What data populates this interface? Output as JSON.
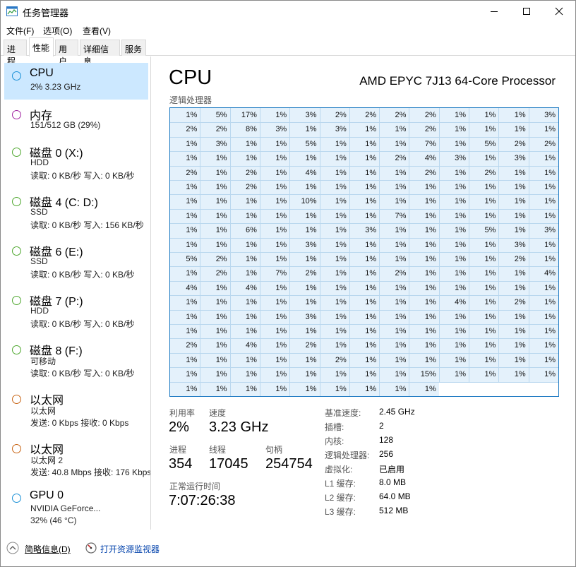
{
  "window": {
    "title": "任务管理器"
  },
  "menu": [
    {
      "label": "文件(F)"
    },
    {
      "label": "选项(O)"
    },
    {
      "label": "查看(V)"
    }
  ],
  "tabs": [
    {
      "label": "进程"
    },
    {
      "label": "性能"
    },
    {
      "label": "用户"
    },
    {
      "label": "详细信息"
    },
    {
      "label": "服务"
    }
  ],
  "sidebar": {
    "items": [
      {
        "title": "CPU",
        "lines": [
          "2% 3.23 GHz"
        ],
        "color": "#1a90d6"
      },
      {
        "title": "内存",
        "lines": [
          "151/512 GB (29%)"
        ],
        "color": "#a024a0"
      },
      {
        "title": "磁盘 0 (X:)",
        "lines": [
          "HDD",
          "读取: 0 KB/秒 写入: 0 KB/秒"
        ],
        "color": "#4ea72e"
      },
      {
        "title": "磁盘 4 (C: D:)",
        "lines": [
          "SSD",
          "读取: 0 KB/秒 写入: 156 KB/秒"
        ],
        "color": "#4ea72e"
      },
      {
        "title": "磁盘 6 (E:)",
        "lines": [
          "SSD",
          "读取: 0 KB/秒 写入: 0 KB/秒"
        ],
        "color": "#4ea72e"
      },
      {
        "title": "磁盘 7 (P:)",
        "lines": [
          "HDD",
          "读取: 0 KB/秒 写入: 0 KB/秒"
        ],
        "color": "#4ea72e"
      },
      {
        "title": "磁盘 8 (F:)",
        "lines": [
          "可移动",
          "读取: 0 KB/秒 写入: 0 KB/秒"
        ],
        "color": "#4ea72e"
      },
      {
        "title": "以太网",
        "lines": [
          "以太网",
          "发送: 0 Kbps 接收: 0 Kbps"
        ],
        "color": "#c86414"
      },
      {
        "title": "以太网",
        "lines": [
          "以太网 2",
          "发送: 40.8 Mbps 接收: 176 Kbps"
        ],
        "color": "#c86414"
      },
      {
        "title": "GPU 0",
        "lines": [
          "NVIDIA GeForce...",
          "32% (46 °C)"
        ],
        "color": "#1a90d6"
      }
    ]
  },
  "cpu": {
    "title": "CPU",
    "model": "AMD EPYC 7J13 64-Core Processor",
    "grid_label": "逻辑处理器",
    "grid_columns": 13,
    "cores": [
      "1%",
      "5%",
      "17%",
      "1%",
      "3%",
      "2%",
      "2%",
      "2%",
      "2%",
      "1%",
      "1%",
      "1%",
      "3%",
      "2%",
      "2%",
      "8%",
      "3%",
      "1%",
      "3%",
      "1%",
      "1%",
      "2%",
      "1%",
      "1%",
      "1%",
      "1%",
      "1%",
      "3%",
      "1%",
      "1%",
      "5%",
      "1%",
      "1%",
      "1%",
      "7%",
      "1%",
      "5%",
      "2%",
      "2%",
      "1%",
      "1%",
      "1%",
      "1%",
      "1%",
      "1%",
      "1%",
      "2%",
      "4%",
      "3%",
      "1%",
      "3%",
      "1%",
      "2%",
      "1%",
      "2%",
      "1%",
      "4%",
      "1%",
      "1%",
      "1%",
      "2%",
      "1%",
      "2%",
      "1%",
      "1%",
      "1%",
      "1%",
      "2%",
      "1%",
      "1%",
      "1%",
      "1%",
      "1%",
      "1%",
      "1%",
      "1%",
      "1%",
      "1%",
      "1%",
      "1%",
      "1%",
      "1%",
      "10%",
      "1%",
      "1%",
      "1%",
      "1%",
      "1%",
      "1%",
      "1%",
      "1%",
      "1%",
      "1%",
      "1%",
      "1%",
      "1%",
      "1%",
      "1%",
      "7%",
      "1%",
      "1%",
      "1%",
      "1%",
      "1%",
      "1%",
      "1%",
      "6%",
      "1%",
      "1%",
      "1%",
      "3%",
      "1%",
      "1%",
      "1%",
      "5%",
      "1%",
      "3%",
      "1%",
      "1%",
      "1%",
      "1%",
      "3%",
      "1%",
      "1%",
      "1%",
      "1%",
      "1%",
      "1%",
      "3%",
      "1%",
      "5%",
      "2%",
      "1%",
      "1%",
      "1%",
      "1%",
      "1%",
      "1%",
      "1%",
      "1%",
      "1%",
      "2%",
      "1%",
      "1%",
      "2%",
      "1%",
      "7%",
      "2%",
      "1%",
      "1%",
      "2%",
      "1%",
      "1%",
      "1%",
      "1%",
      "4%",
      "4%",
      "1%",
      "4%",
      "1%",
      "1%",
      "1%",
      "1%",
      "1%",
      "1%",
      "1%",
      "1%",
      "1%",
      "1%",
      "1%",
      "1%",
      "1%",
      "1%",
      "1%",
      "1%",
      "1%",
      "1%",
      "1%",
      "4%",
      "1%",
      "2%",
      "1%",
      "1%",
      "1%",
      "1%",
      "1%",
      "3%",
      "1%",
      "1%",
      "1%",
      "1%",
      "1%",
      "1%",
      "1%",
      "1%",
      "1%",
      "1%",
      "1%",
      "1%",
      "1%",
      "1%",
      "1%",
      "1%",
      "1%",
      "1%",
      "1%",
      "1%",
      "1%",
      "2%",
      "1%",
      "4%",
      "1%",
      "2%",
      "1%",
      "1%",
      "1%",
      "1%",
      "1%",
      "1%",
      "1%",
      "1%",
      "1%",
      "1%",
      "1%",
      "1%",
      "1%",
      "2%",
      "1%",
      "1%",
      "1%",
      "1%",
      "1%",
      "1%",
      "1%",
      "1%",
      "1%",
      "1%",
      "1%",
      "1%",
      "1%",
      "1%",
      "1%",
      "15%",
      "1%",
      "1%",
      "1%",
      "1%",
      "1%",
      "1%",
      "1%",
      "1%",
      "1%",
      "1%",
      "1%",
      "1%",
      "1%"
    ],
    "stats": {
      "utilization_label": "利用率",
      "utilization": "2%",
      "speed_label": "速度",
      "speed": "3.23 GHz",
      "processes_label": "进程",
      "processes": "354",
      "threads_label": "线程",
      "threads": "17045",
      "handles_label": "句柄",
      "handles": "254754",
      "uptime_label": "正常运行时间",
      "uptime": "7:07:26:38"
    },
    "details": [
      {
        "label": "基准速度:",
        "value": "2.45 GHz"
      },
      {
        "label": "插槽:",
        "value": "2"
      },
      {
        "label": "内核:",
        "value": "128"
      },
      {
        "label": "逻辑处理器:",
        "value": "256"
      },
      {
        "label": "虚拟化:",
        "value": "已启用"
      },
      {
        "label": "L1 缓存:",
        "value": "8.0 MB"
      },
      {
        "label": "L2 缓存:",
        "value": "64.0 MB"
      },
      {
        "label": "L3 缓存:",
        "value": "512 MB"
      }
    ]
  },
  "footer": {
    "summary_label": "简略信息(D)",
    "monitor_label": "打开资源监视器"
  },
  "colors": {
    "accent": "#1f7bc3",
    "selected_bg": "#cce8ff",
    "cell_bg": "#e4f1fb"
  }
}
